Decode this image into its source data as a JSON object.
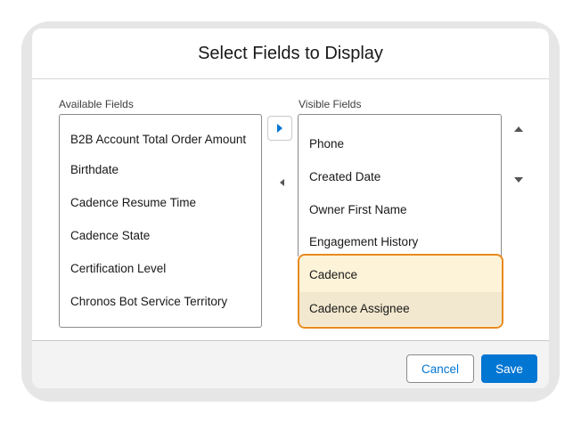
{
  "dialog": {
    "title": "Select Fields to Display"
  },
  "available": {
    "label": "Available Fields",
    "items": [
      "B2B Account Total Order Amount",
      "Birthdate",
      "Cadence Resume Time",
      "Cadence State",
      "Certification Level",
      "Chronos Bot Service Territory"
    ]
  },
  "visible": {
    "label": "Visible Fields",
    "items": [
      "Phone",
      "Created Date",
      "Owner First Name",
      "Engagement History",
      "Cadence",
      "Cadence Assignee"
    ],
    "highlighted": [
      "Cadence",
      "Cadence Assignee"
    ],
    "selected": "Cadence Assignee"
  },
  "controls": {
    "move_to_visible_icon": "right-triangle-icon",
    "move_to_available_icon": "left-triangle-icon",
    "move_up_icon": "up-triangle-icon",
    "move_down_icon": "down-triangle-icon"
  },
  "footer": {
    "cancel_label": "Cancel",
    "save_label": "Save"
  },
  "colors": {
    "accent": "#0176d3",
    "highlight_border": "#e98a1e",
    "highlight_fill": "#fdf3d8"
  }
}
